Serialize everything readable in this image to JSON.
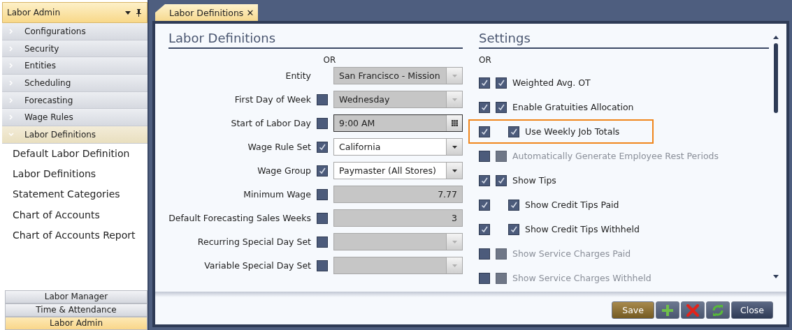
{
  "sidebar": {
    "title": "Labor Admin",
    "sections": [
      {
        "label": "Configurations",
        "expanded": false
      },
      {
        "label": "Security",
        "expanded": false
      },
      {
        "label": "Entities",
        "expanded": false
      },
      {
        "label": "Scheduling",
        "expanded": false
      },
      {
        "label": "Forecasting",
        "expanded": false
      },
      {
        "label": "Wage Rules",
        "expanded": false
      },
      {
        "label": "Labor Definitions",
        "expanded": true,
        "children": [
          "Default Labor Definition",
          "Labor Definitions",
          "Statement Categories",
          "Chart of Accounts",
          "Chart of Accounts Report"
        ]
      }
    ],
    "modules": [
      {
        "label": "Labor Manager",
        "selected": false
      },
      {
        "label": "Time & Attendance",
        "selected": false
      },
      {
        "label": "Labor Admin",
        "selected": true
      }
    ]
  },
  "tabs": [
    {
      "label": "Labor Definitions",
      "close": "✕",
      "selected": true
    }
  ],
  "labor_definitions": {
    "title": "Labor Definitions",
    "or_label": "OR",
    "rows": [
      {
        "label": "Entity",
        "kind": "dropdown",
        "value": "San Francisco - Mission",
        "disabled": true
      },
      {
        "label": "First Day of Week",
        "override": {
          "checked": false
        },
        "kind": "dropdown",
        "value": "Wednesday",
        "disabled": true
      },
      {
        "label": "Start of Labor Day",
        "override": {
          "checked": false
        },
        "kind": "time",
        "value": "9:00 AM",
        "disabled": true
      },
      {
        "label": "Wage Rule Set",
        "override": {
          "checked": true
        },
        "kind": "dropdown",
        "value": "California",
        "disabled": false
      },
      {
        "label": "Wage Group",
        "override": {
          "checked": true
        },
        "kind": "dropdown",
        "value": "Paymaster (All Stores)",
        "disabled": false
      },
      {
        "label": "Minimum Wage",
        "override": {
          "checked": false
        },
        "kind": "number",
        "value": "7.77",
        "disabled": true
      },
      {
        "label": "Default Forecasting Sales Weeks",
        "override": {
          "checked": false
        },
        "kind": "number",
        "value": "3",
        "disabled": true
      },
      {
        "label": "Recurring Special Day Set",
        "override": {
          "checked": false
        },
        "kind": "dropdown",
        "disabled": true
      },
      {
        "label": "Variable Special Day Set",
        "override": {
          "checked": false
        },
        "kind": "dropdown",
        "disabled": true
      }
    ]
  },
  "settings": {
    "title": "Settings",
    "or_label": "OR",
    "items": [
      {
        "label": "Weighted Avg. OT",
        "override": true,
        "checked": true,
        "disabled": false,
        "highlighted": false
      },
      {
        "label": "Enable Gratuities Allocation",
        "override": true,
        "checked": true,
        "disabled": false,
        "highlighted": false,
        "children": [
          {
            "label": "Use Weekly Job Totals",
            "override": true,
            "checked": true,
            "disabled": false,
            "highlighted": true
          }
        ]
      },
      {
        "label": "Automatically Generate Employee Rest Periods",
        "override": false,
        "checked": false,
        "disabled": true,
        "highlighted": false
      },
      {
        "label": "Show Tips",
        "override": true,
        "checked": true,
        "disabled": false,
        "highlighted": false,
        "children": [
          {
            "label": "Show Credit Tips Paid",
            "override": true,
            "checked": true,
            "disabled": false,
            "highlighted": false
          },
          {
            "label": "Show Credit Tips Withheld",
            "override": true,
            "checked": true,
            "disabled": false,
            "highlighted": false
          }
        ]
      },
      {
        "label": "Show Service Charges Paid",
        "override": false,
        "checked": false,
        "disabled": true,
        "highlighted": false
      },
      {
        "label": "Show Service Charges Withheld",
        "override": false,
        "checked": false,
        "disabled": true,
        "highlighted": false
      }
    ]
  },
  "footer_buttons": [
    {
      "kind": "primary",
      "label": "Save"
    },
    {
      "kind": "add"
    },
    {
      "kind": "delete"
    },
    {
      "kind": "refresh"
    },
    {
      "kind": "text",
      "label": "Close"
    }
  ]
}
